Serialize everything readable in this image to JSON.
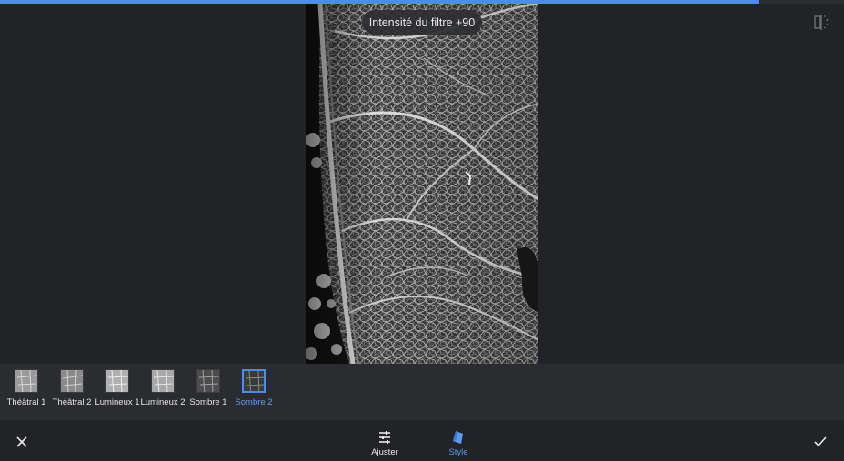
{
  "progress": {
    "fraction": 0.9,
    "color": "#4a8cf0"
  },
  "compare": {
    "icon": "compare-icon"
  },
  "overlay": {
    "intensity_label": "Intensité du filtre +90"
  },
  "filters": [
    {
      "label": "Théâtral 1",
      "selected": false
    },
    {
      "label": "Théâtral 2",
      "selected": false
    },
    {
      "label": "Lumineux 1",
      "selected": false
    },
    {
      "label": "Lumineux 2",
      "selected": false
    },
    {
      "label": "Sombre 1",
      "selected": false
    },
    {
      "label": "Sombre 2",
      "selected": true
    }
  ],
  "bottom_bar": {
    "cancel_icon": "close-icon",
    "confirm_icon": "checkmark-icon",
    "tabs": [
      {
        "label": "Ajuster",
        "icon": "sliders-icon",
        "active": false
      },
      {
        "label": "Style",
        "icon": "style-brush-icon",
        "active": true
      }
    ]
  },
  "colors": {
    "accent": "#4a8cf0",
    "background": "#222326",
    "strip": "#2b2c30"
  }
}
